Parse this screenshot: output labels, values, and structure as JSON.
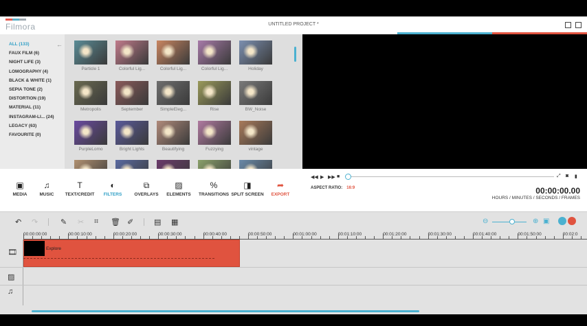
{
  "window": {
    "logo": "Filmora",
    "project_title": "UNTITLED PROJECT *"
  },
  "categories": [
    {
      "label": "ALL (133)",
      "active": true
    },
    {
      "label": "FAUX FILM (6)",
      "active": false
    },
    {
      "label": "NIGHT LIFE (3)",
      "active": false
    },
    {
      "label": "LOMOGRAPHY (4)",
      "active": false
    },
    {
      "label": "BLACK & WHITE (1)",
      "active": false
    },
    {
      "label": "SEPIA TONE (2)",
      "active": false
    },
    {
      "label": "DISTORTION (19)",
      "active": false
    },
    {
      "label": "MATERIAL (11)",
      "active": false
    },
    {
      "label": "INSTAGRAM-LI... (24)",
      "active": false
    },
    {
      "label": "LEGACY (63)",
      "active": false
    },
    {
      "label": "FAVOURITE (0)",
      "active": false
    }
  ],
  "filters": [
    {
      "label": "Particle 1",
      "color": "#5a8c96"
    },
    {
      "label": "Colorful Lig...",
      "color": "#c07a8a"
    },
    {
      "label": "Colorful Lig...",
      "color": "#c98560"
    },
    {
      "label": "Colorful Lig...",
      "color": "#a77aa8"
    },
    {
      "label": "Holiday",
      "color": "#7b8fb0"
    },
    {
      "label": "Metropolis",
      "color": "#6a6a50"
    },
    {
      "label": "September",
      "color": "#8a5a5a"
    },
    {
      "label": "SimpleEleg...",
      "color": "#6e6e6e"
    },
    {
      "label": "Rise",
      "color": "#9a9a5a"
    },
    {
      "label": "BW_Noise",
      "color": "#7a7a7a"
    },
    {
      "label": "PurpleLomo",
      "color": "#6a4aa0"
    },
    {
      "label": "Bright Lights",
      "color": "#5a5a9a"
    },
    {
      "label": "Beautifying",
      "color": "#b08a7a"
    },
    {
      "label": "Fuzzying",
      "color": "#b07aa0"
    },
    {
      "label": "vintage",
      "color": "#a87a5a"
    },
    {
      "label": "",
      "color": "#b09070"
    },
    {
      "label": "",
      "color": "#5a6aa0"
    },
    {
      "label": "",
      "color": "#6a3a6a"
    },
    {
      "label": "",
      "color": "#8aa06a"
    },
    {
      "label": "",
      "color": "#6a8aa8"
    }
  ],
  "toolbar": [
    {
      "label": "MEDIA",
      "icon": "media-icon",
      "glyph": "▣"
    },
    {
      "label": "MUSIC",
      "icon": "music-icon",
      "glyph": "♫"
    },
    {
      "label": "TEXT/CREDIT",
      "icon": "text-icon",
      "glyph": "T"
    },
    {
      "label": "FILTERS",
      "icon": "filters-icon",
      "glyph": "◐"
    },
    {
      "label": "OVERLAYS",
      "icon": "overlays-icon",
      "glyph": "⧉"
    },
    {
      "label": "ELEMENTS",
      "icon": "elements-icon",
      "glyph": "▨"
    },
    {
      "label": "TRANSITIONS",
      "icon": "transitions-icon",
      "glyph": "%"
    },
    {
      "label": "SPLIT SCREEN",
      "icon": "split-screen-icon",
      "glyph": "◨"
    },
    {
      "label": "EXPORT",
      "icon": "export-icon",
      "glyph": "➦"
    }
  ],
  "playback": {
    "aspect_label": "ASPECT RATIO:",
    "aspect_value": "16:9",
    "timecode": "00:00:00.00",
    "timecode_label": "HOURS / MINUTES / SECONDS / FRAMES",
    "progress": 0
  },
  "ruler": [
    "00:00:00:00",
    "00:00:10:00",
    "00:00:20:00",
    "00:00:30:00",
    "00:00:40:00",
    "00:00:50:00",
    "00:01:00:00",
    "00:01:10:00",
    "00:01:20:00",
    "00:01:30:00",
    "00:01:40:00",
    "00:01:50:00",
    "00:02:0"
  ],
  "timeline": {
    "clip_name": "Explore"
  },
  "colors": {
    "accent": "#4bb1d0",
    "export": "#e0533f",
    "clip": "#e0533f"
  }
}
